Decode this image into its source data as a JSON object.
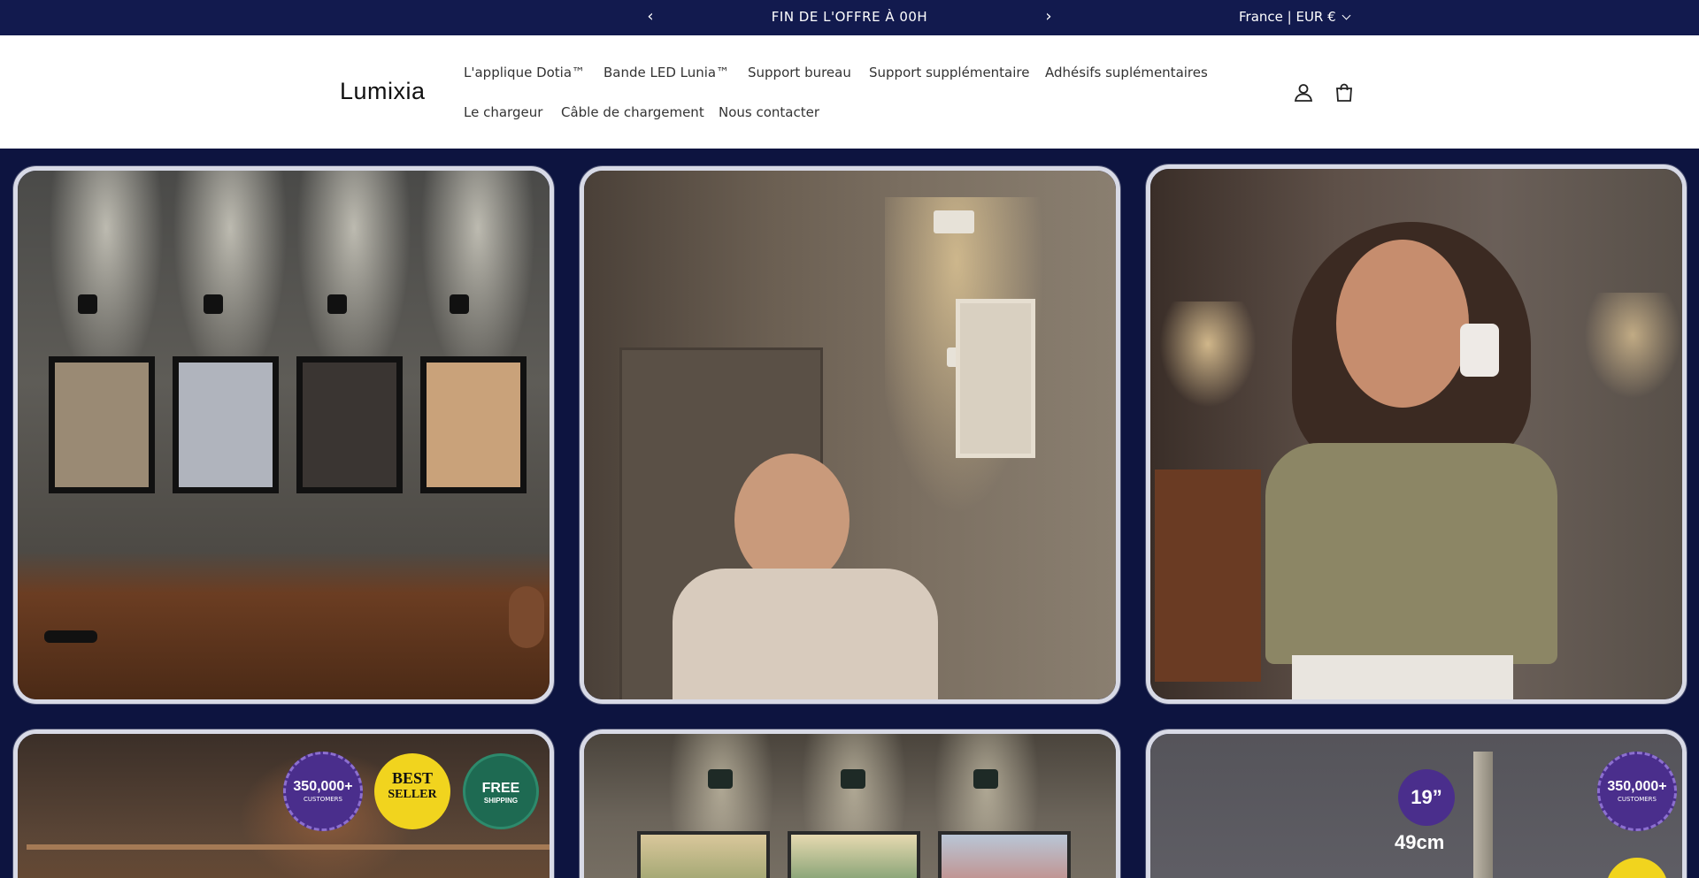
{
  "announcement": {
    "message": "FIN DE L'OFFRE À 00H",
    "locale": "France | EUR €"
  },
  "header": {
    "logo": "Lumixia",
    "nav": [
      "L'applique Dotia™",
      "Bande LED Lunia™",
      "Support bureau",
      "Support supplémentaire",
      "Adhésifs suplémentaires",
      "Le chargeur",
      "Câble de chargement",
      "Nous contacter"
    ]
  },
  "badges": {
    "customers_count": "350,000+",
    "customers_label": "CUSTOMERS",
    "best": "BEST",
    "seller": "SELLER",
    "free": "FREE",
    "shipping": "SHIPPING",
    "size_in": "19”",
    "size_cm": "49cm"
  },
  "colors": {
    "announcement_bg": "#121a4e",
    "page_bg": "#0d1440",
    "header_bg": "#ffffff"
  }
}
